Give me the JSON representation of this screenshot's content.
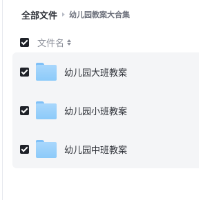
{
  "breadcrumb": {
    "root": "全部文件",
    "current": "幼儿园教案大合集"
  },
  "list_header": {
    "select_all_checked": true,
    "name_column": "文件名",
    "sort_icon": "sort-icon"
  },
  "files": [
    {
      "name": "幼儿园大班教案",
      "type": "folder",
      "icon": "folder-icon",
      "checked": true
    },
    {
      "name": "幼儿园小班教案",
      "type": "folder",
      "icon": "folder-icon",
      "checked": true
    },
    {
      "name": "幼儿园中班教案",
      "type": "folder",
      "icon": "folder-icon",
      "checked": true
    }
  ],
  "colors": {
    "folder": "#8ccaf9",
    "checkbox": "#1f2229",
    "selected_row_bg": "#f4f5f7"
  }
}
